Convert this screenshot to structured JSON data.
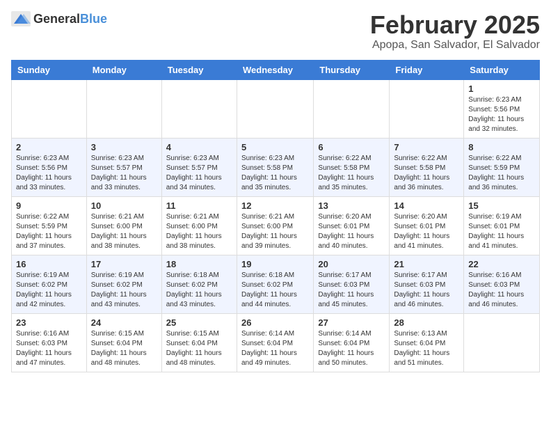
{
  "header": {
    "logo_general": "General",
    "logo_blue": "Blue",
    "month": "February 2025",
    "location": "Apopa, San Salvador, El Salvador"
  },
  "weekdays": [
    "Sunday",
    "Monday",
    "Tuesday",
    "Wednesday",
    "Thursday",
    "Friday",
    "Saturday"
  ],
  "weeks": [
    [
      {
        "day": "",
        "info": ""
      },
      {
        "day": "",
        "info": ""
      },
      {
        "day": "",
        "info": ""
      },
      {
        "day": "",
        "info": ""
      },
      {
        "day": "",
        "info": ""
      },
      {
        "day": "",
        "info": ""
      },
      {
        "day": "1",
        "info": "Sunrise: 6:23 AM\nSunset: 5:56 PM\nDaylight: 11 hours and 32 minutes."
      }
    ],
    [
      {
        "day": "2",
        "info": "Sunrise: 6:23 AM\nSunset: 5:56 PM\nDaylight: 11 hours and 33 minutes."
      },
      {
        "day": "3",
        "info": "Sunrise: 6:23 AM\nSunset: 5:57 PM\nDaylight: 11 hours and 33 minutes."
      },
      {
        "day": "4",
        "info": "Sunrise: 6:23 AM\nSunset: 5:57 PM\nDaylight: 11 hours and 34 minutes."
      },
      {
        "day": "5",
        "info": "Sunrise: 6:23 AM\nSunset: 5:58 PM\nDaylight: 11 hours and 35 minutes."
      },
      {
        "day": "6",
        "info": "Sunrise: 6:22 AM\nSunset: 5:58 PM\nDaylight: 11 hours and 35 minutes."
      },
      {
        "day": "7",
        "info": "Sunrise: 6:22 AM\nSunset: 5:58 PM\nDaylight: 11 hours and 36 minutes."
      },
      {
        "day": "8",
        "info": "Sunrise: 6:22 AM\nSunset: 5:59 PM\nDaylight: 11 hours and 36 minutes."
      }
    ],
    [
      {
        "day": "9",
        "info": "Sunrise: 6:22 AM\nSunset: 5:59 PM\nDaylight: 11 hours and 37 minutes."
      },
      {
        "day": "10",
        "info": "Sunrise: 6:21 AM\nSunset: 6:00 PM\nDaylight: 11 hours and 38 minutes."
      },
      {
        "day": "11",
        "info": "Sunrise: 6:21 AM\nSunset: 6:00 PM\nDaylight: 11 hours and 38 minutes."
      },
      {
        "day": "12",
        "info": "Sunrise: 6:21 AM\nSunset: 6:00 PM\nDaylight: 11 hours and 39 minutes."
      },
      {
        "day": "13",
        "info": "Sunrise: 6:20 AM\nSunset: 6:01 PM\nDaylight: 11 hours and 40 minutes."
      },
      {
        "day": "14",
        "info": "Sunrise: 6:20 AM\nSunset: 6:01 PM\nDaylight: 11 hours and 41 minutes."
      },
      {
        "day": "15",
        "info": "Sunrise: 6:19 AM\nSunset: 6:01 PM\nDaylight: 11 hours and 41 minutes."
      }
    ],
    [
      {
        "day": "16",
        "info": "Sunrise: 6:19 AM\nSunset: 6:02 PM\nDaylight: 11 hours and 42 minutes."
      },
      {
        "day": "17",
        "info": "Sunrise: 6:19 AM\nSunset: 6:02 PM\nDaylight: 11 hours and 43 minutes."
      },
      {
        "day": "18",
        "info": "Sunrise: 6:18 AM\nSunset: 6:02 PM\nDaylight: 11 hours and 43 minutes."
      },
      {
        "day": "19",
        "info": "Sunrise: 6:18 AM\nSunset: 6:02 PM\nDaylight: 11 hours and 44 minutes."
      },
      {
        "day": "20",
        "info": "Sunrise: 6:17 AM\nSunset: 6:03 PM\nDaylight: 11 hours and 45 minutes."
      },
      {
        "day": "21",
        "info": "Sunrise: 6:17 AM\nSunset: 6:03 PM\nDaylight: 11 hours and 46 minutes."
      },
      {
        "day": "22",
        "info": "Sunrise: 6:16 AM\nSunset: 6:03 PM\nDaylight: 11 hours and 46 minutes."
      }
    ],
    [
      {
        "day": "23",
        "info": "Sunrise: 6:16 AM\nSunset: 6:03 PM\nDaylight: 11 hours and 47 minutes."
      },
      {
        "day": "24",
        "info": "Sunrise: 6:15 AM\nSunset: 6:04 PM\nDaylight: 11 hours and 48 minutes."
      },
      {
        "day": "25",
        "info": "Sunrise: 6:15 AM\nSunset: 6:04 PM\nDaylight: 11 hours and 48 minutes."
      },
      {
        "day": "26",
        "info": "Sunrise: 6:14 AM\nSunset: 6:04 PM\nDaylight: 11 hours and 49 minutes."
      },
      {
        "day": "27",
        "info": "Sunrise: 6:14 AM\nSunset: 6:04 PM\nDaylight: 11 hours and 50 minutes."
      },
      {
        "day": "28",
        "info": "Sunrise: 6:13 AM\nSunset: 6:04 PM\nDaylight: 11 hours and 51 minutes."
      },
      {
        "day": "",
        "info": ""
      }
    ]
  ]
}
